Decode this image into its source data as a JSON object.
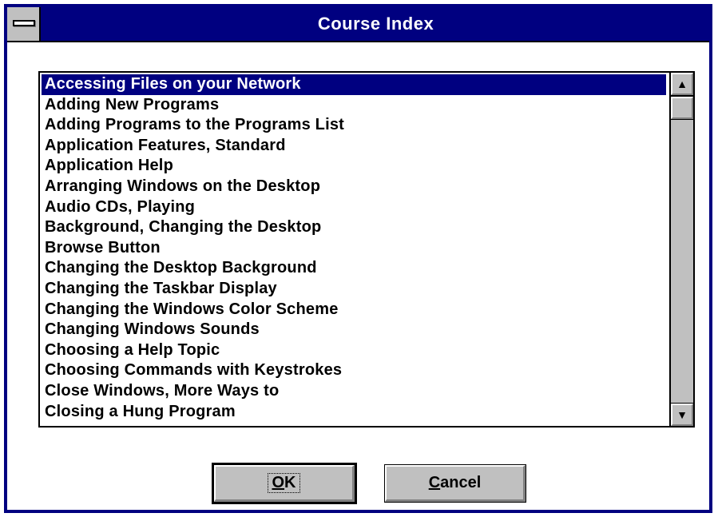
{
  "window": {
    "title": "Course Index"
  },
  "list": {
    "selected_index": 0,
    "items": [
      "Accessing Files on your Network",
      "Adding New Programs",
      "Adding Programs to the Programs List",
      "Application Features, Standard",
      "Application Help",
      "Arranging Windows on the Desktop",
      "Audio CDs, Playing",
      "Background, Changing the Desktop",
      "Browse Button",
      "Changing the Desktop Background",
      "Changing the Taskbar Display",
      "Changing the Windows Color Scheme",
      "Changing Windows Sounds",
      "Choosing a Help Topic",
      "Choosing Commands with Keystrokes",
      "Close Windows, More Ways to",
      "Closing a Hung Program"
    ]
  },
  "scrollbar": {
    "up_icon": "arrow-up-icon",
    "down_icon": "arrow-down-icon",
    "up_glyph": "▲",
    "down_glyph": "▼"
  },
  "buttons": {
    "ok": {
      "mnemonic": "O",
      "rest": "K"
    },
    "cancel": {
      "mnemonic": "C",
      "rest": "ancel"
    }
  },
  "colors": {
    "title_bar": "#000080",
    "selection": "#000080",
    "button_face": "#c0c0c0"
  }
}
